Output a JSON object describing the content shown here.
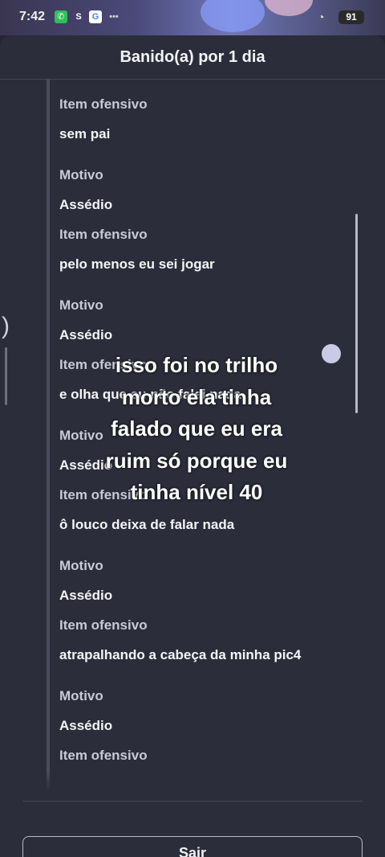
{
  "status_bar": {
    "time": "7:42",
    "icons": [
      "whatsapp-icon",
      "s-icon",
      "google-icon",
      "more-dots-icon"
    ],
    "s_glyph": "S",
    "g_glyph": "G",
    "battery": "91"
  },
  "dialog": {
    "title": "Banido(a) por 1 dia",
    "entries": [
      {
        "label": "Item ofensivo",
        "value": "sem pai"
      },
      {
        "label": "Motivo",
        "value": "Assédio"
      },
      {
        "label": "Item ofensivo",
        "value": "pelo menos eu sei jogar"
      },
      {
        "label": "Motivo",
        "value": "Assédio"
      },
      {
        "label": "Item ofensivo",
        "value": "e olha que eu não falei nada"
      },
      {
        "label": "Motivo",
        "value": "Assédio"
      },
      {
        "label": "Item ofensivo",
        "value": "ô louco deixa de falar nada"
      },
      {
        "label": "Motivo",
        "value": "Assédio"
      },
      {
        "label": "Item ofensivo",
        "value": "atrapalhando a cabeça da minha pic4"
      },
      {
        "label": "Motivo",
        "value": "Assédio"
      },
      {
        "label": "Item ofensivo",
        "value": ""
      }
    ],
    "exit_label": "Sair"
  },
  "caption": "isso foi no trilho\nmorto ela tinha\nfalado que eu era\nruim só porque eu\ntinha nível 40",
  "colors": {
    "sheet_bg": "#2b2d3a",
    "label_text": "#c8cad6",
    "value_text": "#f5f5f8"
  }
}
